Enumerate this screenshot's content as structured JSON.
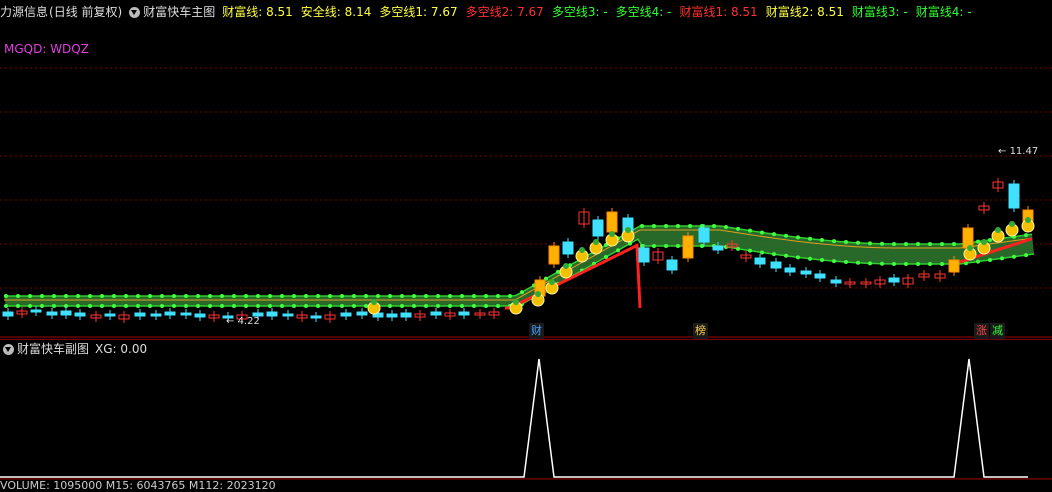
{
  "header": {
    "app": "力源信息",
    "period": "(日线 前复权)",
    "indicator": "财富快车主图",
    "items": [
      {
        "label": "财富线: 8.51",
        "color": "#ffff40"
      },
      {
        "label": "安全线: 8.14",
        "color": "#ffff40"
      },
      {
        "label": "多空线1: 7.67",
        "color": "#ffff40"
      },
      {
        "label": "多空线2: 7.67",
        "color": "#ff3030"
      },
      {
        "label": "多空线3: -",
        "color": "#30ff30"
      },
      {
        "label": "多空线4: -",
        "color": "#30ff30"
      },
      {
        "label": "财富线1: 8.51",
        "color": "#ff3030"
      },
      {
        "label": "财富线2: 8.51",
        "color": "#ffff40"
      },
      {
        "label": "财富线3: -",
        "color": "#30ff30"
      },
      {
        "label": "财富线4: -",
        "color": "#30ff30"
      }
    ]
  },
  "overlay": {
    "mgqd": "MGQD: WDQZ"
  },
  "main_chart": {
    "low_marker": "4.22",
    "high_marker": "11.47",
    "signals": [
      {
        "text": "财",
        "color": "#40a0ff"
      },
      {
        "text": "榜",
        "color": "#ffcc40"
      },
      {
        "text": "涨",
        "color": "#ff4040"
      },
      {
        "text": "减",
        "color": "#30ff30"
      }
    ]
  },
  "sub": {
    "title": "财富快车副图",
    "value_label": "XG: 0.00"
  },
  "bottom": {
    "text": "VOLUME: 1095000 M15: 6043765 M112: 2023120"
  },
  "colors": {
    "up": "#ff3232",
    "down": "#40e0ff",
    "band": "#2f7a2f",
    "grid": "#7a0000"
  },
  "chart_data": {
    "type": "candlestick",
    "high": 11.47,
    "low": 4.22,
    "signal_days": [
      35,
      46,
      65,
      66
    ],
    "xg_peaks": [
      35,
      64
    ]
  }
}
